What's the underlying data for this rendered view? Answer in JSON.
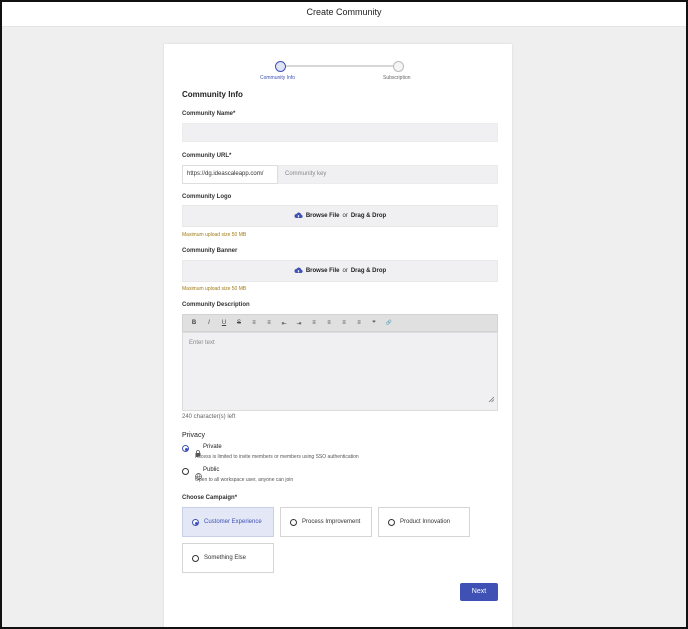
{
  "window": {
    "title": "Create Community"
  },
  "stepper": {
    "steps": [
      {
        "label": "Community Info",
        "active": true
      },
      {
        "label": "Subscription",
        "active": false
      }
    ]
  },
  "form": {
    "section_title": "Community Info",
    "community_name": {
      "label": "Community Name",
      "required": "*",
      "value": ""
    },
    "community_url": {
      "label": "Community URL",
      "required": "*",
      "prefix": "https://dg.ideascaleapp.com/",
      "placeholder": "Community key"
    },
    "logo": {
      "label": "Community Logo",
      "browse": "Browse File",
      "or": "or",
      "drag": "Drag & Drop",
      "hint": "Maximum upload size 50 MB"
    },
    "banner": {
      "label": "Community Banner",
      "browse": "Browse File",
      "or": "or",
      "drag": "Drag & Drop",
      "hint": "Maximum upload size 50 MB"
    },
    "description": {
      "label": "Community Description",
      "toolbar": [
        "B",
        "I",
        "U",
        "S",
        "≡",
        "≡",
        "⇤",
        "⇥",
        "≡",
        "≡",
        "≡",
        "≡",
        "❞",
        "🔗"
      ],
      "placeholder": "Enter text",
      "chars_left": "240 character(s) left"
    },
    "privacy": {
      "label": "Privacy",
      "options": [
        {
          "title": "Private",
          "desc": "Access is limited to invite members or members using SSO authentication",
          "checked": true,
          "icon": "lock-icon"
        },
        {
          "title": "Public",
          "desc": "Open to all workspace user, anyone can join",
          "checked": false,
          "icon": "globe-icon"
        }
      ]
    },
    "campaign": {
      "label": "Choose Campaign",
      "required": "*",
      "options": [
        {
          "label": "Customer Experience",
          "selected": true
        },
        {
          "label": "Process Improvement",
          "selected": false
        },
        {
          "label": "Product Innovation",
          "selected": false
        },
        {
          "label": "Something Else",
          "selected": false
        }
      ]
    },
    "next_label": "Next"
  },
  "colors": {
    "accent": "#3f51b5",
    "hint": "#a07a14",
    "field_bg": "#f0f0f3"
  }
}
